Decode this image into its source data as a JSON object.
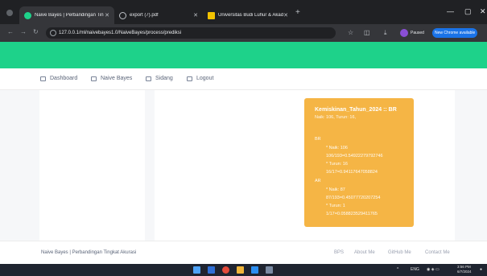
{
  "browser": {
    "tabs": [
      {
        "title": "Naive Bayes | Perbandingan Tin",
        "icon": "green-circle-icon",
        "active": true
      },
      {
        "title": "export (7).pdf",
        "icon": "globe-icon",
        "active": false
      },
      {
        "title": "Universitas Budi Luhur & Akad",
        "icon": "yellow-square-icon",
        "active": false
      }
    ],
    "url": "127.0.0.1/ml/naivebayes1.0/NaiveBayes/process/prediksi",
    "profile_label": "Paused",
    "new_chrome_label": "New Chrome available"
  },
  "nav": {
    "items": [
      {
        "label": "Dashboard",
        "icon": "grid-icon"
      },
      {
        "label": "Naive Bayes",
        "icon": "table-icon"
      },
      {
        "label": "Sidang",
        "icon": "table-icon"
      },
      {
        "label": "Logout",
        "icon": "table-icon"
      }
    ]
  },
  "result": {
    "title": "Kemiskinan_Tahun_2024 :: BR",
    "summary": "Naik: 106, Turun: 16,",
    "br_label": "BR",
    "br_lines": [
      "* Naik: 106",
      "106/193=0.54922279792746",
      "* Turun: 16",
      "16/17=0.94117647058824"
    ],
    "ar_label": "AR",
    "ar_lines": [
      "* Naik: 87",
      "87/193=0.45077720207254",
      "* Turun: 1",
      "1/17=0.058823529411765"
    ]
  },
  "footer": {
    "left": "Naive Bayes | Perbandingan Tingkat Akurasi",
    "links": [
      "BPS",
      "About Me",
      "GitHub Me",
      "Contact Me"
    ]
  },
  "taskbar": {
    "lang": "ENG",
    "time": "3:56 PM",
    "date": "6/7/2024"
  },
  "colors": {
    "hero": "#1ed28a",
    "card": "#f5b545"
  }
}
